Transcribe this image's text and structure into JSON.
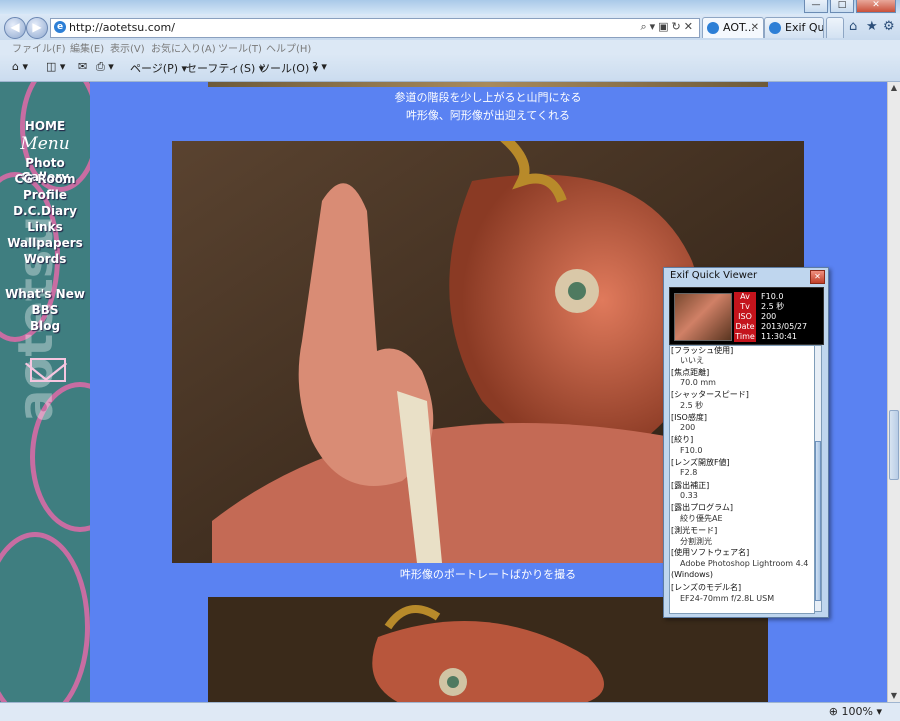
{
  "browser": {
    "url": "http://aotetsu.com/",
    "tabs": [
      {
        "label": "AOT...",
        "active": true
      },
      {
        "label": "Exif Qui...",
        "active": false
      }
    ],
    "menu": [
      "ファイル(F)",
      "編集(E)",
      "表示(V)",
      "お気に入り(A)",
      "ツール(T)",
      "ヘルプ(H)"
    ],
    "commands": {
      "page": "ページ(P)",
      "safety": "セーフティ(S)",
      "tools": "ツール(O)"
    },
    "zoom": "100%"
  },
  "sidebar": {
    "links": [
      "HOME",
      "Photo Gallery",
      "CG Room",
      "Profile",
      "D.C.Diary",
      "Links",
      "Wallpapers",
      "Words",
      "What's New",
      "BBS",
      "Blog"
    ],
    "menu_label": "Menu",
    "mail_icon": "mail-icon"
  },
  "content": {
    "caption_top_1": "参道の階段を少し上がると山門になる",
    "caption_top_2": "吽形像、阿形像が出迎えてくれる",
    "caption_bottom": "吽形像のポートレートばかりを撮る"
  },
  "exif_viewer": {
    "title": "Exif Quick Viewer",
    "summary": [
      {
        "tag": "Av",
        "value": "F10.0"
      },
      {
        "tag": "Tv",
        "value": "2.5 秒"
      },
      {
        "tag": "ISO",
        "value": "200"
      },
      {
        "tag": "Date",
        "value": "2013/05/27"
      },
      {
        "tag": "Time",
        "value": "11:30:41"
      }
    ],
    "details": [
      {
        "label": "[フラッシュ使用]",
        "value": "いいえ"
      },
      {
        "label": "[焦点距離]",
        "value": "70.0 mm"
      },
      {
        "label": "[シャッタースピード]",
        "value": "2.5 秒"
      },
      {
        "label": "[ISO感度]",
        "value": "200"
      },
      {
        "label": "[絞り]",
        "value": "F10.0"
      },
      {
        "label": "[レンズ開放F値]",
        "value": "F2.8"
      },
      {
        "label": "[露出補正]",
        "value": "0.33"
      },
      {
        "label": "[露出プログラム]",
        "value": "絞り優先AE"
      },
      {
        "label": "[測光モード]",
        "value": "分割測光"
      },
      {
        "label": "[使用ソフトウェア名]",
        "value": "Adobe Photoshop Lightroom 4.4"
      },
      {
        "label": "",
        "value": "(Windows)"
      },
      {
        "label": "[レンズのモデル名]",
        "value": "EF24-70mm f/2.8L USM"
      }
    ]
  }
}
